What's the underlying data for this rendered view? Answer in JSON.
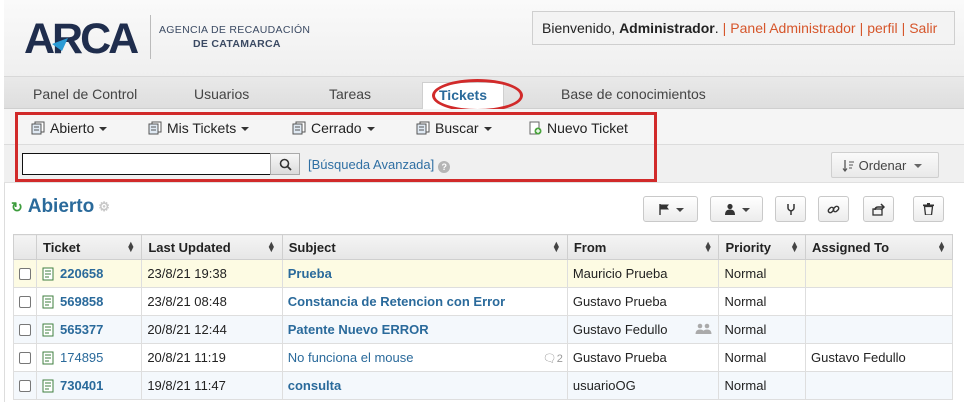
{
  "logo": {
    "brand": "ARCA",
    "line1": "AGENCIA DE RECAUDACIÓN",
    "line2": "DE CATAMARCA"
  },
  "welcome": {
    "greeting": "Bienvenido, ",
    "user": "Administrador",
    "suffix": ".",
    "links": [
      "Panel Administrador",
      "perfil",
      "Salir"
    ]
  },
  "tabs": [
    "Panel de Control",
    "Usuarios",
    "Tareas",
    "Tickets",
    "Base de conocimientos"
  ],
  "toolbar": {
    "items": [
      "Abierto",
      "Mis Tickets",
      "Cerrado",
      "Buscar",
      "Nuevo Ticket"
    ]
  },
  "search": {
    "value": "",
    "advanced_label": "[Búsqueda Avanzada]",
    "sort_label": "Ordenar"
  },
  "page": {
    "title": "Abierto"
  },
  "table": {
    "columns": [
      "Ticket",
      "Last Updated",
      "Subject",
      "From",
      "Priority",
      "Assigned To"
    ],
    "rows": [
      {
        "ticket": "220658",
        "updated": "23/8/21 19:38",
        "subject": "Prueba",
        "from": "Mauricio Prueba",
        "priority": "Normal",
        "assigned": "",
        "unread": true,
        "thread": "",
        "collab": false
      },
      {
        "ticket": "569858",
        "updated": "23/8/21 08:48",
        "subject": "Constancia de Retencion con Error",
        "from": "Gustavo Prueba",
        "priority": "Normal",
        "assigned": "",
        "unread": true,
        "thread": "",
        "collab": false
      },
      {
        "ticket": "565377",
        "updated": "20/8/21 12:44",
        "subject": "Patente Nuevo ERROR",
        "from": "Gustavo Fedullo",
        "priority": "Normal",
        "assigned": "",
        "unread": true,
        "thread": "",
        "collab": true
      },
      {
        "ticket": "174895",
        "updated": "20/8/21 11:19",
        "subject": "No funciona el mouse",
        "from": "Gustavo Prueba",
        "priority": "Normal",
        "assigned": "Gustavo Fedullo",
        "unread": false,
        "thread": "2",
        "collab": false
      },
      {
        "ticket": "730401",
        "updated": "19/8/21 11:47",
        "subject": "consulta",
        "from": "usuarioOG",
        "priority": "Normal",
        "assigned": "",
        "unread": true,
        "thread": "",
        "collab": false
      }
    ]
  },
  "colors": {
    "accent": "#2a6a9b",
    "link_orange": "#d6562b",
    "annotation_red": "#d12a2a",
    "row_yellow": "#fdfbe3"
  }
}
